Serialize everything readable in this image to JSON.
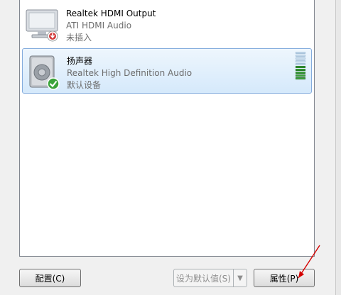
{
  "devices": [
    {
      "name": "Realtek HDMI Output",
      "driver": "ATI HDMI Audio",
      "status": "未插入",
      "icon": "monitor-icon",
      "badge": "unplugged-badge"
    },
    {
      "name": "扬声器",
      "driver": "Realtek High Definition Audio",
      "status": "默认设备",
      "icon": "speaker-icon",
      "badge": "default-check-badge",
      "selected": true,
      "level_bars_lit": 5,
      "level_bars_total": 10
    }
  ],
  "buttons": {
    "configure_label": "配置(C)",
    "set_default_label": "设为默认值(S)",
    "properties_label": "属性(P)"
  },
  "colors": {
    "selection_border": "#84acdd",
    "check_green": "#3aa33a",
    "unplugged_red": "#d23b3b",
    "annotation_red": "#d40000"
  }
}
